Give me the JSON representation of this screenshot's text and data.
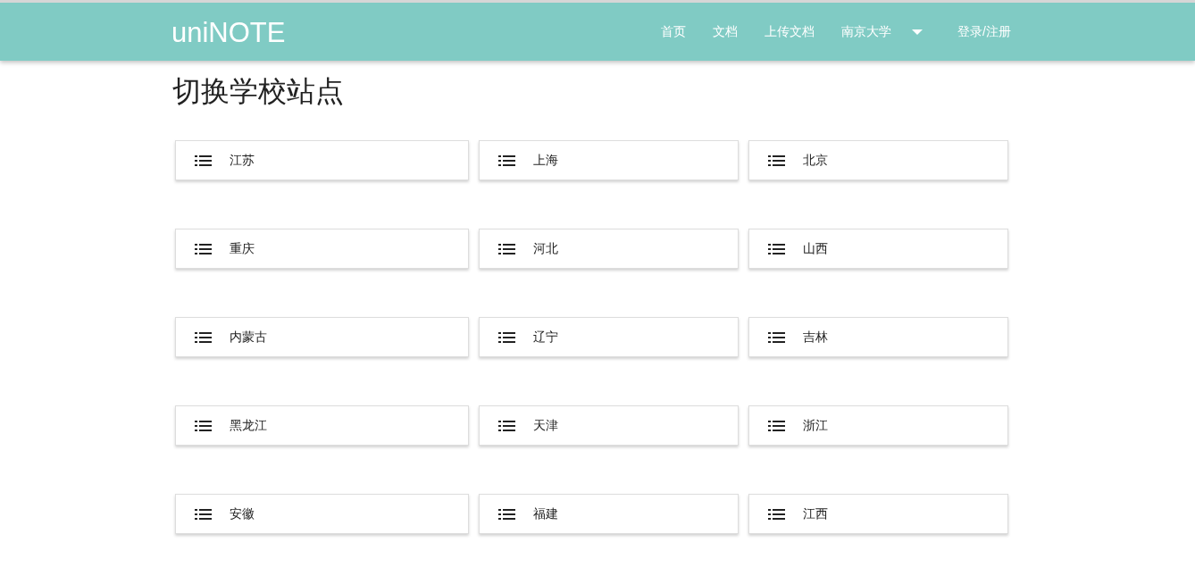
{
  "navbar": {
    "brand": "uniNOTE",
    "links": [
      "首页",
      "文档",
      "上传文档",
      "南京大学"
    ],
    "login": "登录/注册"
  },
  "page_title": "切换学校站点",
  "regions": [
    {
      "label": "江苏"
    },
    {
      "label": "上海"
    },
    {
      "label": "北京"
    },
    {
      "label": "重庆"
    },
    {
      "label": "河北"
    },
    {
      "label": "山西"
    },
    {
      "label": "内蒙古"
    },
    {
      "label": "辽宁"
    },
    {
      "label": "吉林"
    },
    {
      "label": "黑龙江"
    },
    {
      "label": "天津"
    },
    {
      "label": "浙江"
    },
    {
      "label": "安徽"
    },
    {
      "label": "福建"
    },
    {
      "label": "江西"
    }
  ]
}
